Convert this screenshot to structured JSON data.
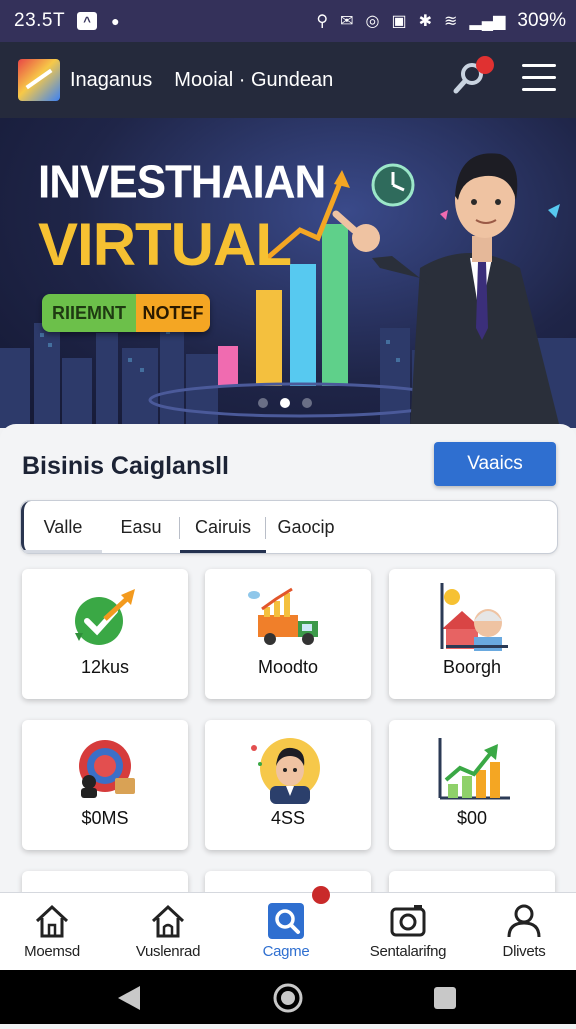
{
  "status_bar": {
    "time": "23.5T",
    "battery": "309%"
  },
  "app_bar": {
    "brand": "Inaganus",
    "subtitle": "Mooial · Gundean",
    "notification_count": ""
  },
  "banner": {
    "headline_1": "INVESTHAIAN",
    "headline_2": "VIRTUAL",
    "pill_left": "RIIEMNT",
    "pill_right": "NOTEF",
    "slides": 3,
    "active_slide": 2
  },
  "section": {
    "title": "Bisinis Caiglansll",
    "action_label": "Vaaics",
    "tabs": [
      {
        "label": "Valle"
      },
      {
        "label": "Easu"
      },
      {
        "label": "Cairuis"
      },
      {
        "label": "Gaocip"
      }
    ]
  },
  "tiles": [
    {
      "label": "12kus",
      "icon": "check-growth-icon"
    },
    {
      "label": "Moodto",
      "icon": "truck-chart-icon"
    },
    {
      "label": "Boorgh",
      "icon": "worker-house-icon"
    },
    {
      "label": "$0MS",
      "icon": "target-person-icon"
    },
    {
      "label": "4SS",
      "icon": "person-avatar-icon"
    },
    {
      "label": "$00",
      "icon": "bar-chart-icon"
    }
  ],
  "bottom_nav": {
    "badge": "",
    "items": [
      {
        "label": "Moemsd",
        "icon": "home-icon"
      },
      {
        "label": "Vuslenrad",
        "icon": "home-outline-icon"
      },
      {
        "label": "Cagme",
        "icon": "search-icon",
        "active": true
      },
      {
        "label": "Sentalarifng",
        "icon": "camera-icon"
      },
      {
        "label": "Dlivets",
        "icon": "user-icon"
      }
    ]
  },
  "colors": {
    "primary": "#2f6fd0",
    "status_bar": "#34315a",
    "app_bar": "#252a3c",
    "accent_yellow": "#f6c132"
  }
}
